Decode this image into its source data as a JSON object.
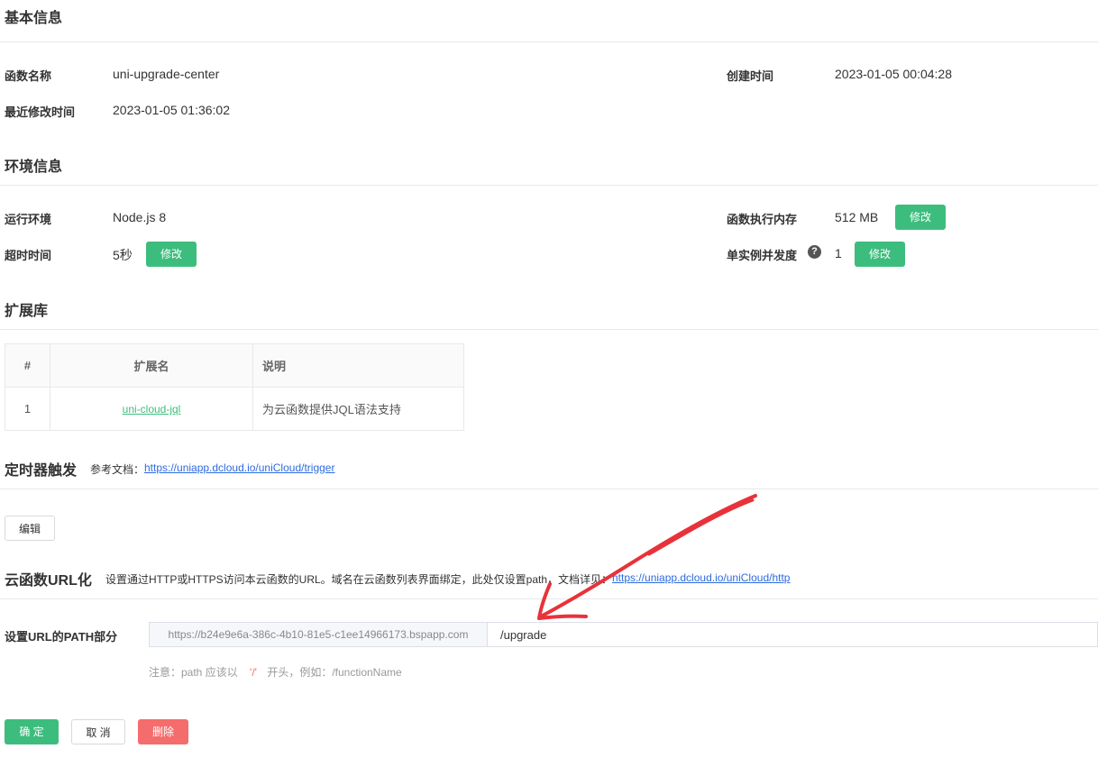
{
  "basic": {
    "title": "基本信息",
    "func_name_label": "函数名称",
    "func_name_value": "uni-upgrade-center",
    "created_label": "创建时间",
    "created_value": "2023-01-05 00:04:28",
    "modified_label": "最近修改时间",
    "modified_value": "2023-01-05 01:36:02"
  },
  "env": {
    "title": "环境信息",
    "runtime_label": "运行环境",
    "runtime_value": "Node.js 8",
    "memory_label": "函数执行内存",
    "memory_value": "512 MB",
    "memory_edit": "修改",
    "timeout_label": "超时时间",
    "timeout_value": "5秒",
    "timeout_edit": "修改",
    "concurrency_label": "单实例并发度",
    "concurrency_help": "?",
    "concurrency_value": "1",
    "concurrency_edit": "修改"
  },
  "ext": {
    "title": "扩展库",
    "headers": [
      "#",
      "扩展名",
      "说明"
    ],
    "rows": [
      {
        "index": "1",
        "name": "uni-cloud-jql",
        "desc": "为云函数提供JQL语法支持"
      }
    ]
  },
  "timer": {
    "title": "定时器触发",
    "doc_prefix": "参考文档：",
    "doc_link": "https://uniapp.dcloud.io/uniCloud/trigger",
    "edit_button": "编辑"
  },
  "url": {
    "title": "云函数URL化",
    "desc": "设置通过HTTP或HTTPS访问本云函数的URL。域名在云函数列表界面绑定，此处仅设置path，文档详见：",
    "doc_link": "https://uniapp.dcloud.io/uniCloud/http",
    "path_label": "设置URL的PATH部分",
    "prefix": "https://b24e9e6a-386c-4b10-81e5-c1ee14966173.bspapp.com",
    "path_value": "/upgrade",
    "note_prefix": "注意：path 应该以",
    "note_slash": "'/'",
    "note_suffix": "开头，例如：/functionName"
  },
  "actions": {
    "confirm": "确 定",
    "cancel": "取 消",
    "delete": "删除"
  },
  "colors": {
    "accent_green": "#3dbd7d",
    "danger_red": "#f56c6c",
    "link_blue": "#2d6be0",
    "annotation_red": "#e8323a"
  }
}
